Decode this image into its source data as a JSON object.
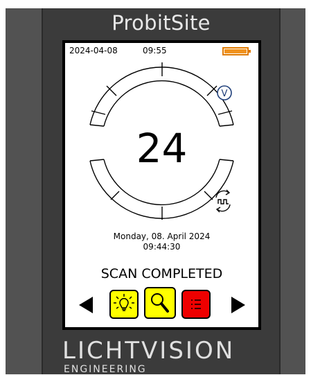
{
  "device": {
    "title": "ProbitSite",
    "brand": "LICHTVISION",
    "brand_sub": "ENGINEERING"
  },
  "status_bar": {
    "date": "2024-04-08",
    "time": "09:55",
    "battery_level": 1.0
  },
  "dial": {
    "value": "24",
    "v_badge": "V",
    "segments_lit": 0
  },
  "datetime": {
    "date_text": "Monday, 08. April 2024",
    "time_text": "09:44:30"
  },
  "scan": {
    "status": "SCAN COMPLETED"
  },
  "controls": {
    "prev_icon": "arrow-left-icon",
    "next_icon": "arrow-right-icon",
    "modes": [
      {
        "icon": "lightbulb-icon",
        "color": "#ffff00"
      },
      {
        "icon": "magnifier-icon",
        "color": "#ffff00"
      },
      {
        "icon": "list-icon",
        "color": "#ee0000"
      }
    ]
  },
  "colors": {
    "device_body": "#3b3b3b",
    "battery": "#f0921e",
    "badge": "#1f3f7a"
  }
}
